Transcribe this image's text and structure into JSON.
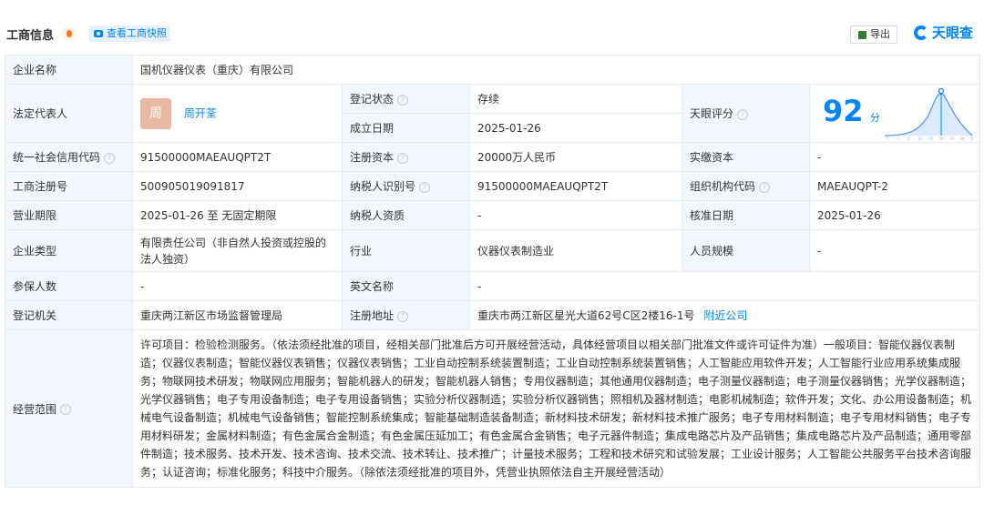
{
  "header": {
    "title": "工商信息",
    "snapshot_btn": "查看工商快照",
    "export_btn": "导出",
    "logo_text": "天眼查"
  },
  "rows": {
    "company_name_label": "企业名称",
    "company_name": "国机仪器仪表（重庆）有限公司",
    "legal_rep_label": "法定代表人",
    "legal_rep_avatar": "周",
    "legal_rep_name": "周开荃",
    "reg_status_label": "登记状态",
    "reg_status": "存续",
    "found_date_label": "成立日期",
    "found_date": "2025-01-26",
    "score_label": "天眼评分",
    "score_value": "92",
    "score_unit": "分",
    "credit_code_label": "统一社会信用代码",
    "credit_code": "91500000MAEAUQPT2T",
    "reg_capital_label": "注册资本",
    "reg_capital": "20000万人民币",
    "paid_capital_label": "实缴资本",
    "paid_capital": "-",
    "reg_no_label": "工商注册号",
    "reg_no": "500905019091817",
    "taxpayer_id_label": "纳税人识别号",
    "taxpayer_id": "91500000MAEAUQPT2T",
    "org_code_label": "组织机构代码",
    "org_code": "MAEAUQPT-2",
    "term_label": "营业期限",
    "term": "2025-01-26 至 无固定期限",
    "taxpayer_qual_label": "纳税人资质",
    "taxpayer_qual": "-",
    "approve_date_label": "核准日期",
    "approve_date": "2025-01-26",
    "company_type_label": "企业类型",
    "company_type": "有限责任公司（非自然人投资或控股的法人独资）",
    "industry_label": "行业",
    "industry": "仪器仪表制造业",
    "staff_size_label": "人员规模",
    "staff_size": "-",
    "insured_label": "参保人数",
    "insured": "-",
    "english_name_label": "英文名称",
    "english_name": "-",
    "reg_authority_label": "登记机关",
    "reg_authority": "重庆两江新区市场监督管理局",
    "reg_address_label": "注册地址",
    "reg_address": "重庆市两江新区星光大道62号C区2楼16-1号",
    "nearby_link": "附近公司",
    "scope_label": "经营范围",
    "scope": "许可项目：检验检测服务。（依法须经批准的项目，经相关部门批准后方可开展经营活动，具体经营项目以相关部门批准文件或许可证件为准）一般项目：智能仪器仪表制造；仪器仪表制造；智能仪器仪表销售；仪器仪表销售；工业自动控制系统装置制造；工业自动控制系统装置销售；人工智能应用软件开发；人工智能行业应用系统集成服务；物联网技术研发；物联网应用服务；智能机器人的研发；智能机器人销售；专用仪器制造；其他通用仪器制造；电子测量仪器制造；电子测量仪器销售；光学仪器制造；光学仪器销售；电子专用设备制造；电子专用设备销售；实验分析仪器制造；实验分析仪器销售；照相机及器材制造；电影机械制造；软件开发；文化、办公用设备制造；机械电气设备制造；机械电气设备销售；智能控制系统集成；智能基础制造装备制造；新材料技术研发；新材料技术推广服务；电子专用材料制造；电子专用材料销售；电子专用材料研发；金属材料制造；有色金属合金制造；有色金属压延加工；有色金属合金销售；电子元器件制造；集成电路芯片及产品销售；集成电路芯片及产品制造；通用零部件制造；技术服务、技术开发、技术咨询、技术交流、技术转让、技术推广；计量技术服务；工程和技术研究和试验发展；工业设计服务；人工智能公共服务平台技术咨询服务；认证咨询；标准化服务；科技中介服务。（除依法须经批准的项目外，凭营业执照依法自主开展经营活动）"
  },
  "score_chart": {
    "x_ticks": [
      "0",
      "7",
      "5",
      "10",
      "30",
      "50",
      "70",
      "90",
      "100"
    ],
    "accent": "#0084ff"
  },
  "help_glyph": "?"
}
